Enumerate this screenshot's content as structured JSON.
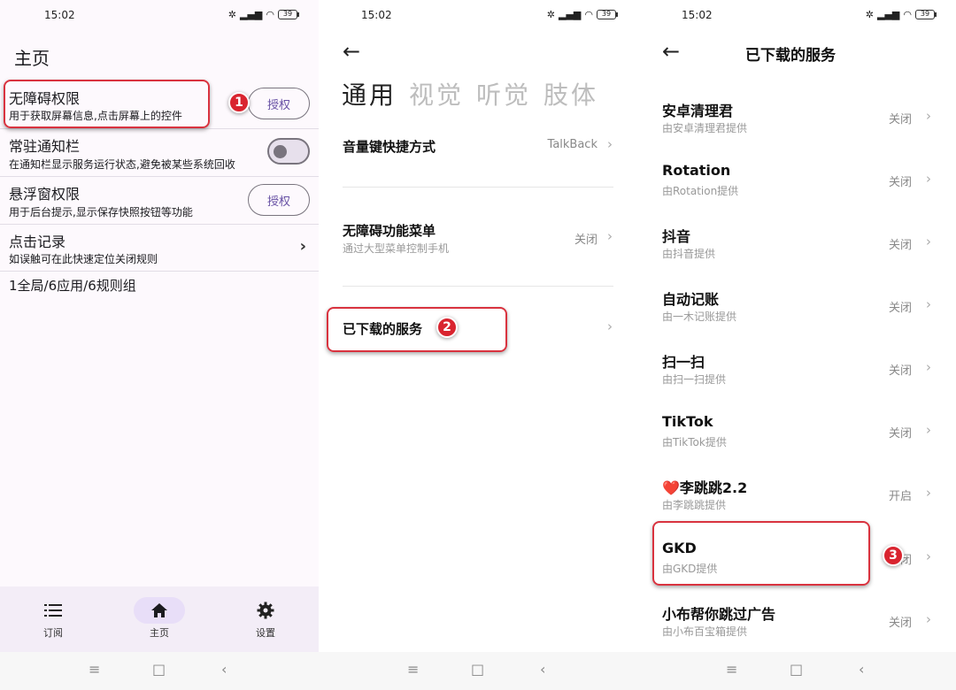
{
  "status": {
    "time": "15:02",
    "battery": "39"
  },
  "screen1": {
    "title": "主页",
    "rows": [
      {
        "title": "无障碍权限",
        "desc": "用于获取屏幕信息,点击屏幕上的控件",
        "button": "授权"
      },
      {
        "title": "常驻通知栏",
        "desc": "在通知栏显示服务运行状态,避免被某些系统回收"
      },
      {
        "title": "悬浮窗权限",
        "desc": "用于后台提示,显示保存快照按钮等功能",
        "button": "授权"
      },
      {
        "title": "点击记录",
        "desc": "如误触可在此快速定位关闭规则"
      }
    ],
    "summary": "1全局/6应用/6规则组",
    "nav": [
      {
        "label": "订阅",
        "icon": "list-icon"
      },
      {
        "label": "主页",
        "icon": "home-icon",
        "active": true
      },
      {
        "label": "设置",
        "icon": "gear-icon"
      }
    ]
  },
  "screen2": {
    "tabs": [
      "通用",
      "视觉",
      "听觉",
      "肢体"
    ],
    "rows": [
      {
        "title": "音量键快捷方式",
        "value": "TalkBack"
      },
      {
        "title": "无障碍功能菜单",
        "desc": "通过大型菜单控制手机",
        "value": "关闭"
      },
      {
        "title": "已下载的服务"
      }
    ]
  },
  "screen3": {
    "title": "已下载的服务",
    "services": [
      {
        "name": "安卓清理君",
        "provider": "由安卓清理君提供",
        "state": "关闭"
      },
      {
        "name": "Rotation",
        "provider": "由Rotation提供",
        "state": "关闭"
      },
      {
        "name": "抖音",
        "provider": "由抖音提供",
        "state": "关闭"
      },
      {
        "name": "自动记账",
        "provider": "由一木记账提供",
        "state": "关闭"
      },
      {
        "name": "扫一扫",
        "provider": "由扫一扫提供",
        "state": "关闭"
      },
      {
        "name": "TikTok",
        "provider": "由TikTok提供",
        "state": "关闭"
      },
      {
        "name": "❤️李跳跳2.2",
        "provider": "由李跳跳提供",
        "state": "开启"
      },
      {
        "name": "GKD",
        "provider": "由GKD提供",
        "state": "闭"
      },
      {
        "name": "小布帮你跳过广告",
        "provider": "由小布百宝箱提供",
        "state": "关闭"
      }
    ]
  },
  "annotations": {
    "badge1": "1",
    "badge2": "2",
    "badge3": "3",
    "color": "#d9333f"
  },
  "colors": {
    "accent": "#6750a4",
    "nav_bg": "#f3edf7",
    "nav_active": "#e8def8"
  }
}
